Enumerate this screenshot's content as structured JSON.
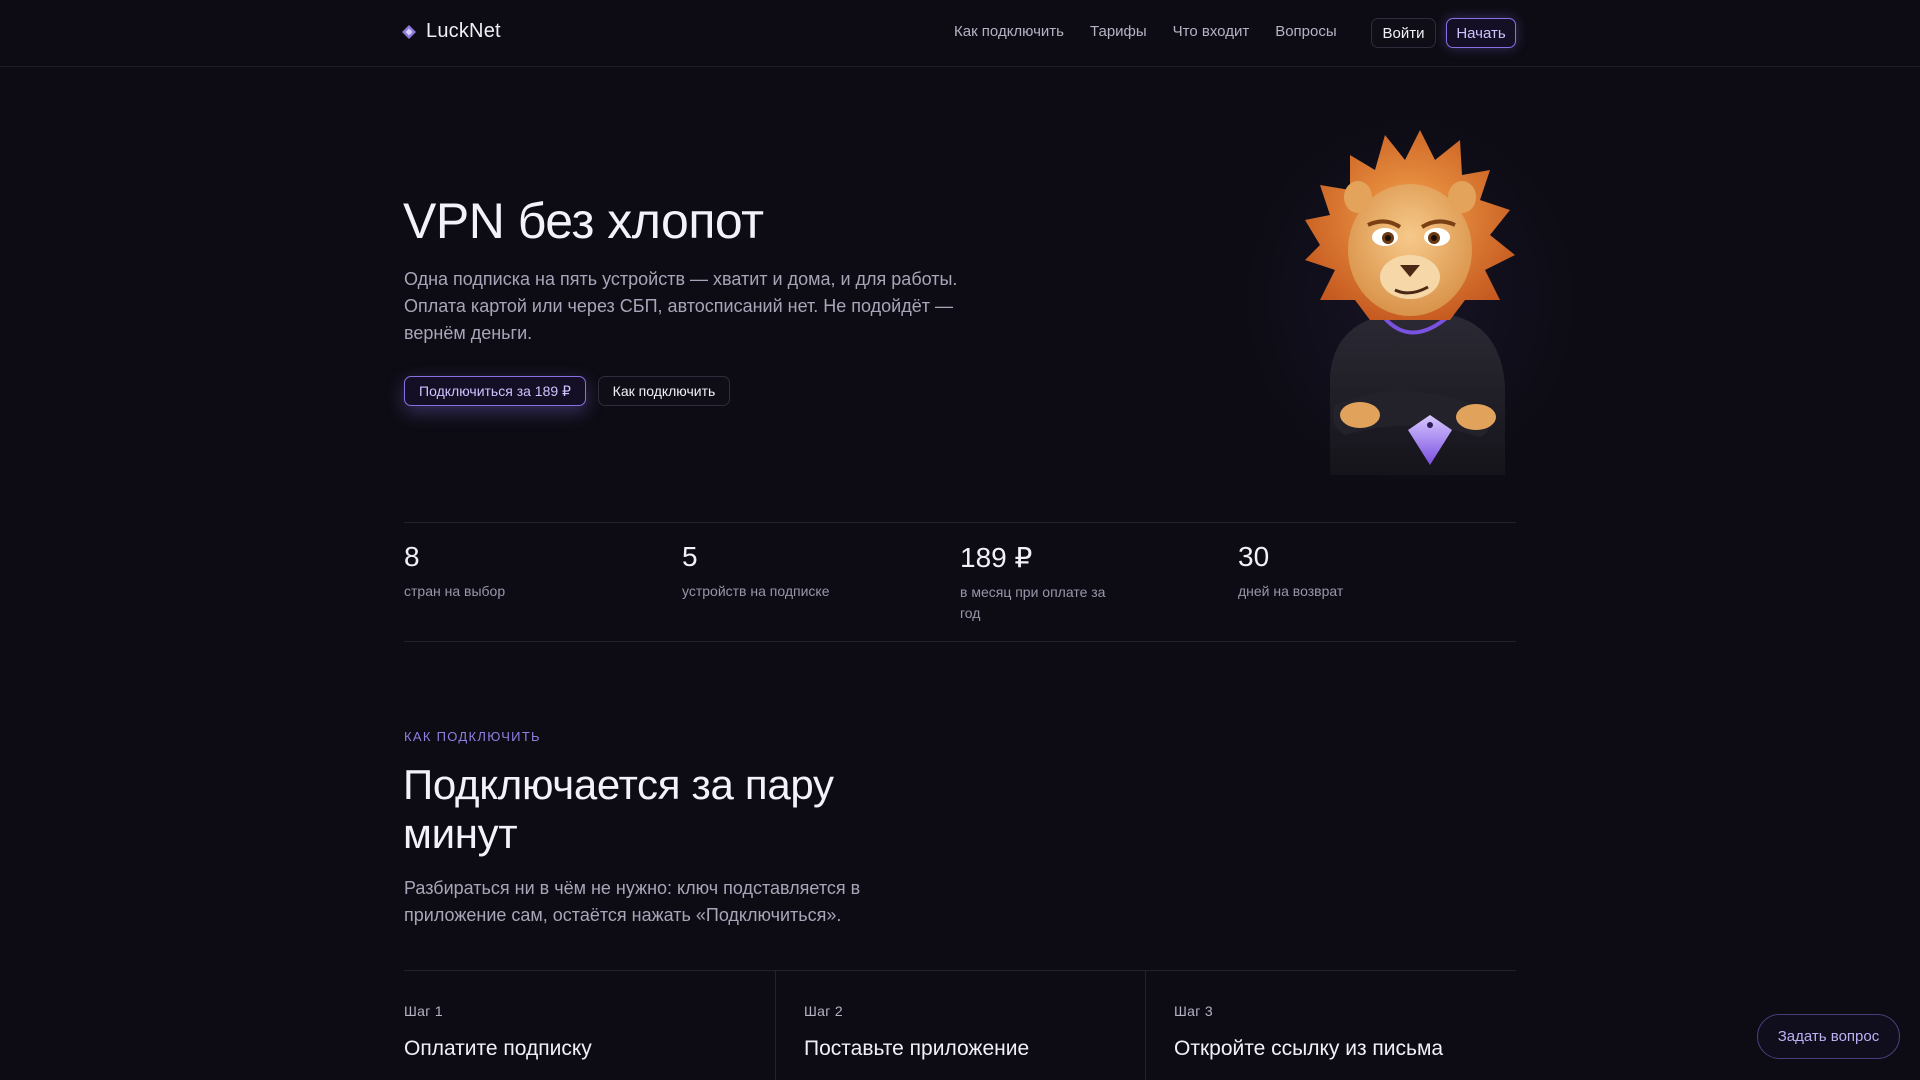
{
  "brand": {
    "name": "LuckNet",
    "accent": "#8a6fe6"
  },
  "header": {
    "nav": [
      "Как подключить",
      "Тарифы",
      "Что входит",
      "Вопросы"
    ],
    "login_label": "Войти",
    "start_label": "Начать"
  },
  "hero": {
    "title": "VPN без хлопот",
    "text": "Одна подписка на пять устройств — хватит и дома, и для работы. Оплата картой или через СБП, автосписаний нет. Не подойдёт — вернём деньги.",
    "primary_label": "Подключиться за 189 ₽",
    "secondary_label": "Как подключить",
    "mascot_icon": "lion-mascot"
  },
  "stats": [
    {
      "value": "8",
      "label": "стран на выбор"
    },
    {
      "value": "5",
      "label": "устройств на подписке"
    },
    {
      "value": "189 ₽",
      "label": "в месяц при оплате за год"
    },
    {
      "value": "30",
      "label": "дней на возврат"
    }
  ],
  "how": {
    "eyebrow": "КАК ПОДКЛЮЧИТЬ",
    "title": "Подключается за пару минут",
    "text": "Разбираться ни в чём не нужно: ключ подставляется в приложение сам, остаётся нажать «Подключиться».",
    "steps": [
      {
        "num": "Шаг 1",
        "title": "Оплатите подписку"
      },
      {
        "num": "Шаг 2",
        "title": "Поставьте приложение"
      },
      {
        "num": "Шаг 3",
        "title": "Откройте ссылку из письма"
      }
    ]
  },
  "ask_label": "Задать вопрос"
}
